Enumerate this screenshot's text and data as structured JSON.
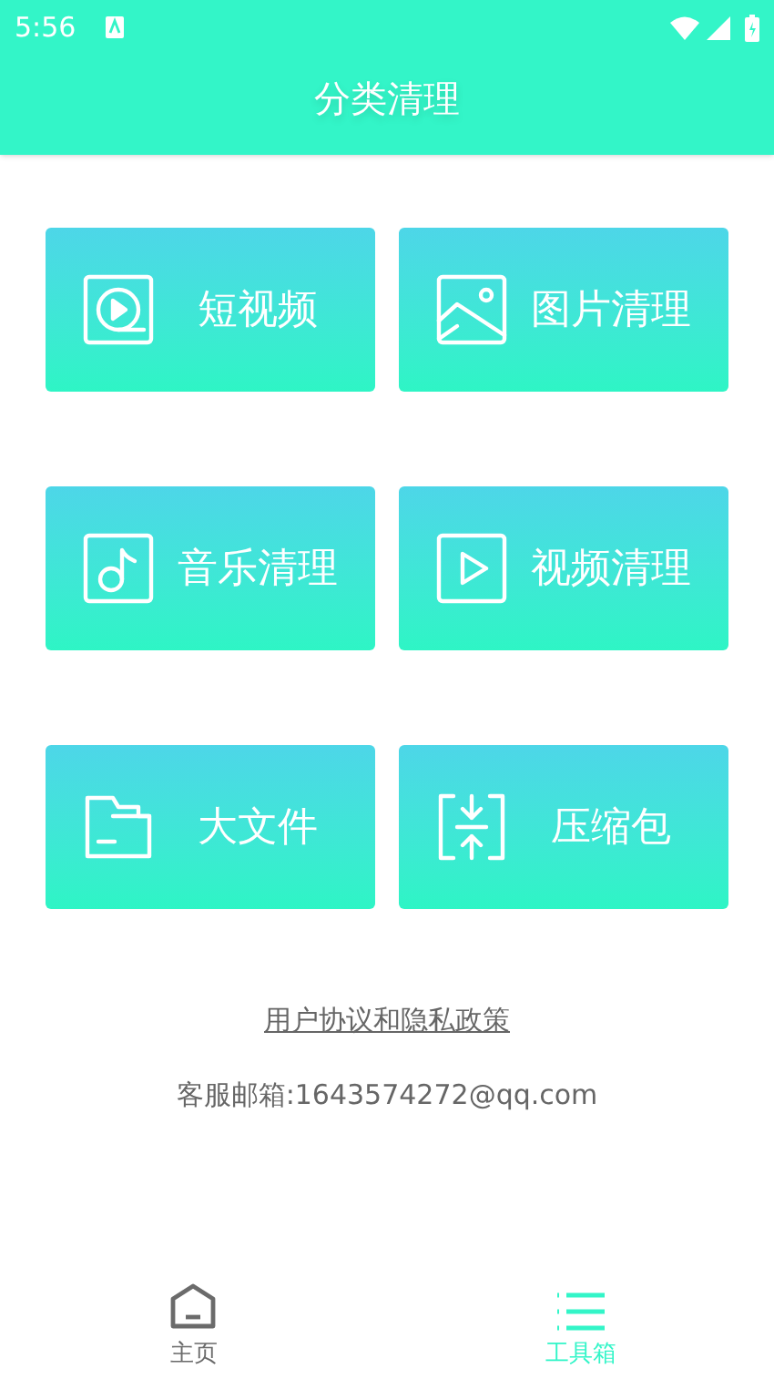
{
  "status_bar": {
    "time": "5:56"
  },
  "header": {
    "title": "分类清理"
  },
  "cards": [
    {
      "label": "短视频",
      "kind": "short-video"
    },
    {
      "label": "图片清理",
      "kind": "image"
    },
    {
      "label": "音乐清理",
      "kind": "music"
    },
    {
      "label": "视频清理",
      "kind": "video"
    },
    {
      "label": "大文件",
      "kind": "folder"
    },
    {
      "label": "压缩包",
      "kind": "archive"
    }
  ],
  "agreement_link": "用户协议和隐私政策",
  "contact": "客服邮箱:1643574272@qq.com",
  "bottom_nav": [
    {
      "label": "主页",
      "kind": "home",
      "selected": false
    },
    {
      "label": "工具箱",
      "kind": "list",
      "selected": true
    }
  ]
}
